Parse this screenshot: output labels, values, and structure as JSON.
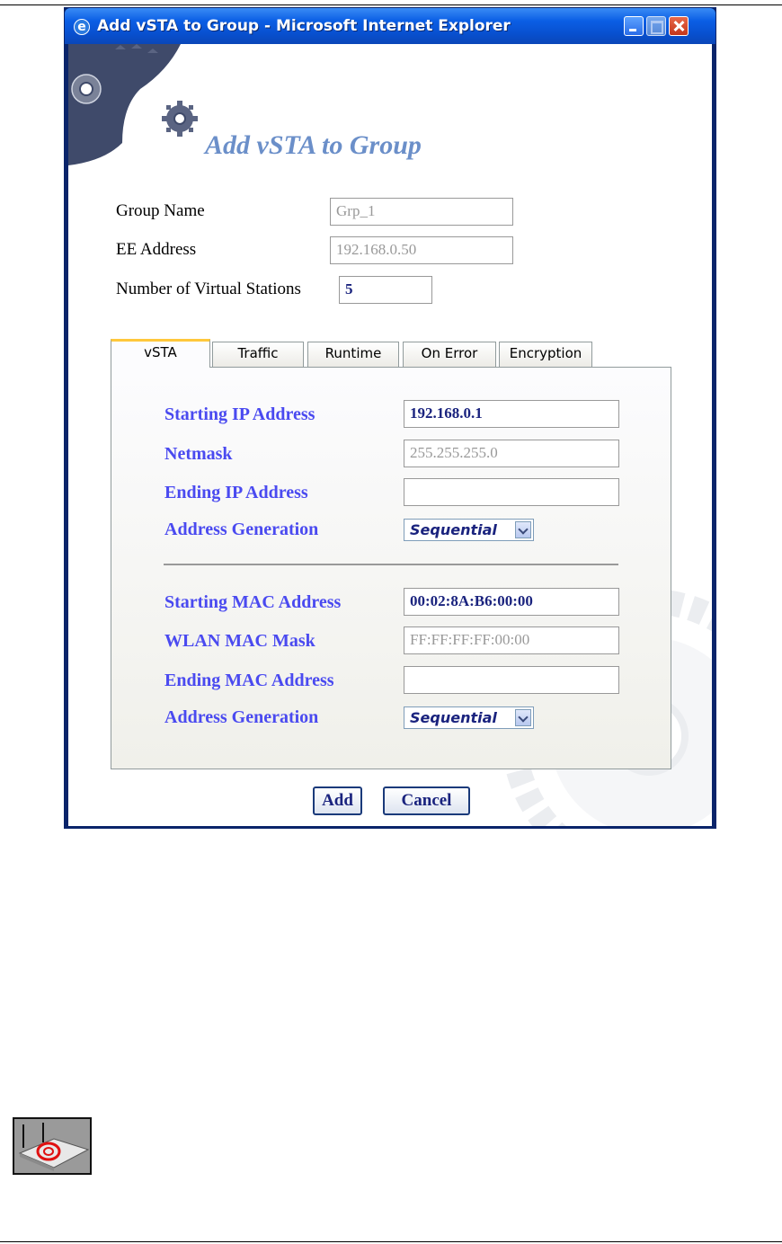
{
  "window": {
    "title": "Add vSTA to Group - Microsoft Internet Explorer"
  },
  "dialog": {
    "heading": "Add vSTA to Group",
    "fields": {
      "group_name_label": "Group Name",
      "group_name_value": "Grp_1",
      "ee_address_label": "EE Address",
      "ee_address_value": "192.168.0.50",
      "num_stations_label": "Number of Virtual Stations",
      "num_stations_value": "5"
    },
    "tabs": [
      "vSTA",
      "Traffic",
      "Runtime",
      "On Error",
      "Encryption"
    ],
    "active_tab": "vSTA",
    "ip": {
      "starting_label": "Starting IP Address",
      "starting_value": "192.168.0.1",
      "netmask_label": "Netmask",
      "netmask_value": "255.255.255.0",
      "ending_label": "Ending IP Address",
      "ending_value": "",
      "generation_label": "Address Generation",
      "generation_value": "Sequential"
    },
    "mac": {
      "starting_label": "Starting MAC Address",
      "starting_value": "00:02:8A:B6:00:00",
      "mask_label": "WLAN MAC Mask",
      "mask_value": "FF:FF:FF:FF:00:00",
      "ending_label": "Ending MAC Address",
      "ending_value": "",
      "generation_label": "Address Generation",
      "generation_value": "Sequential"
    },
    "buttons": {
      "add": "Add",
      "cancel": "Cancel"
    }
  },
  "icons": {
    "window": "internet-explorer-icon",
    "note": "router-note-icon"
  },
  "colors": {
    "heading": "#6b8fc9",
    "panel_label": "#4a4af0",
    "titlebar": "#0b5fe5",
    "active_tab_accent": "#ffc83c"
  }
}
